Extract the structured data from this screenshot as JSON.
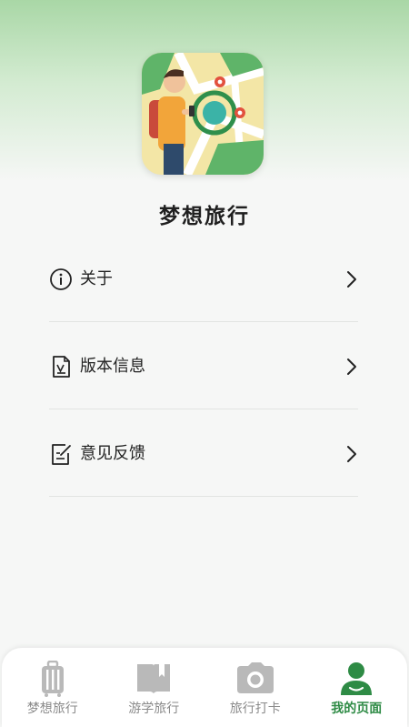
{
  "app": {
    "name": "梦想旅行",
    "logo_icon": "traveler-map-logo"
  },
  "menu": {
    "items": [
      {
        "label": "关于",
        "icon": "info-icon"
      },
      {
        "label": "版本信息",
        "icon": "version-document-icon"
      },
      {
        "label": "意见反馈",
        "icon": "feedback-edit-icon"
      }
    ]
  },
  "tabbar": {
    "tabs": [
      {
        "label": "梦想旅行",
        "icon": "luggage-icon",
        "active": false
      },
      {
        "label": "游学旅行",
        "icon": "book-icon",
        "active": false
      },
      {
        "label": "旅行打卡",
        "icon": "camera-icon",
        "active": false
      },
      {
        "label": "我的页面",
        "icon": "user-icon",
        "active": true
      }
    ]
  },
  "colors": {
    "accent": "#2e8b45",
    "inactive_icon": "#b9b9b9",
    "header_green": "#a9d7a6"
  }
}
